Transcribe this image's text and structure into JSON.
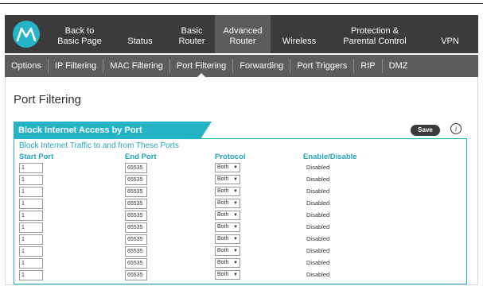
{
  "main_nav": {
    "logo_icon": "motorola-logo-icon",
    "items": [
      {
        "line1": "Back to",
        "line2": "Basic Page",
        "active": false
      },
      {
        "line1": "",
        "line2": "Status",
        "active": false
      },
      {
        "line1": "Basic",
        "line2": "Router",
        "active": false
      },
      {
        "line1": "Advanced",
        "line2": "Router",
        "active": true
      },
      {
        "line1": "",
        "line2": "Wireless",
        "active": false
      },
      {
        "line1": "Protection &",
        "line2": "Parental Control",
        "active": false
      },
      {
        "line1": "",
        "line2": "VPN",
        "active": false
      }
    ]
  },
  "sub_nav": {
    "items": [
      "Options",
      "IP Filtering",
      "MAC Filtering",
      "Port Filtering",
      "Forwarding",
      "Port Triggers",
      "RIP",
      "DMZ"
    ],
    "active_index": 3
  },
  "page": {
    "title": "Port Filtering"
  },
  "section": {
    "tab_label": "Block Internet Access by Port",
    "save_label": "Save",
    "info_icon": "info-icon",
    "info_glyph": "i",
    "subheading": "Block Internet Traffic to and from These Ports",
    "columns": [
      "Start Port",
      "End Port",
      "Protocol",
      "Enable/Disable"
    ]
  },
  "rows": [
    {
      "start": "1",
      "end": "65535",
      "protocol": "Both",
      "status": "Disabled"
    },
    {
      "start": "1",
      "end": "65535",
      "protocol": "Both",
      "status": "Disabled"
    },
    {
      "start": "1",
      "end": "65535",
      "protocol": "Both",
      "status": "Disabled"
    },
    {
      "start": "1",
      "end": "65535",
      "protocol": "Both",
      "status": "Disabled"
    },
    {
      "start": "1",
      "end": "65535",
      "protocol": "Both",
      "status": "Disabled"
    },
    {
      "start": "1",
      "end": "65535",
      "protocol": "Both",
      "status": "Disabled"
    },
    {
      "start": "1",
      "end": "65535",
      "protocol": "Both",
      "status": "Disabled"
    },
    {
      "start": "1",
      "end": "65535",
      "protocol": "Both",
      "status": "Disabled"
    },
    {
      "start": "1",
      "end": "65535",
      "protocol": "Both",
      "status": "Disabled"
    },
    {
      "start": "1",
      "end": "65535",
      "protocol": "Both",
      "status": "Disabled"
    }
  ],
  "colors": {
    "accent": "#24b3c7",
    "nav_bg": "#3b3b3b",
    "subnav_bg": "#5c5c5c"
  }
}
